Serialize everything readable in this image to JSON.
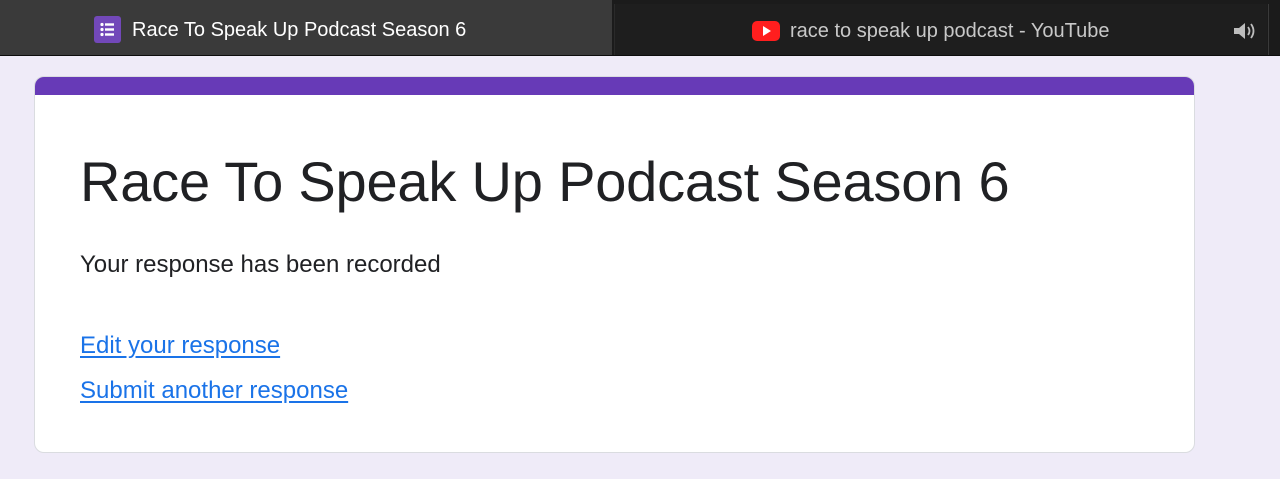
{
  "browser": {
    "tabs": [
      {
        "title": "Race To Speak Up Podcast Season 6",
        "icon": "google-forms-icon",
        "active": true
      },
      {
        "title": "race to speak up podcast - YouTube",
        "icon": "youtube-icon",
        "active": false,
        "audio": "speaker-icon"
      }
    ]
  },
  "form": {
    "accent_color": "#673ab7",
    "title": "Race To Speak Up Podcast Season 6",
    "confirmation": "Your response has been recorded",
    "links": {
      "edit": "Edit your response",
      "submit_another": "Submit another response"
    },
    "link_color": "#1a73e8"
  }
}
